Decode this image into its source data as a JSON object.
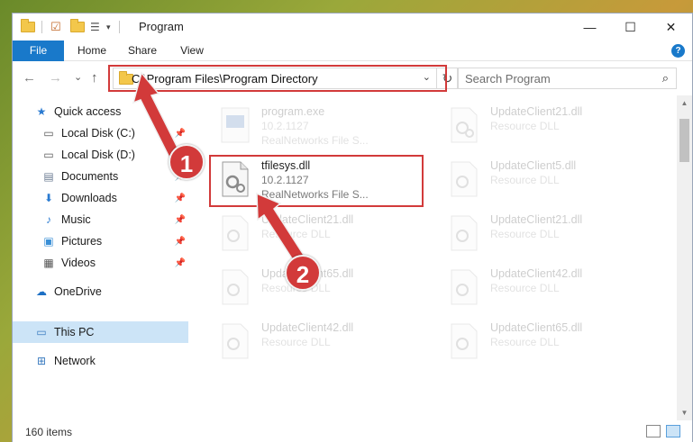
{
  "window": {
    "title": "Program",
    "controls": {
      "minimize": "—",
      "maximize": "☐",
      "close": "✕"
    }
  },
  "ribbon": {
    "tabs": [
      "File",
      "Home",
      "Share",
      "View"
    ],
    "help": "?"
  },
  "nav": {
    "back": "←",
    "forward": "→",
    "recent": "⌄",
    "up": "↑",
    "address": "C:\\Program Files\\Program Directory",
    "refresh": "↻",
    "search_placeholder": "Search Program"
  },
  "sidebar": {
    "items": [
      {
        "label": "Quick access",
        "icon": "star-icon",
        "pinned": false
      },
      {
        "label": "Local Disk (C:)",
        "icon": "drive-icon",
        "pinned": true
      },
      {
        "label": "Local Disk (D:)",
        "icon": "drive-icon",
        "pinned": true
      },
      {
        "label": "Documents",
        "icon": "documents-icon",
        "pinned": true
      },
      {
        "label": "Downloads",
        "icon": "downloads-icon",
        "pinned": true
      },
      {
        "label": "Music",
        "icon": "music-icon",
        "pinned": true
      },
      {
        "label": "Pictures",
        "icon": "pictures-icon",
        "pinned": true
      },
      {
        "label": "Videos",
        "icon": "videos-icon",
        "pinned": true
      },
      {
        "label": "OneDrive",
        "icon": "cloud-icon",
        "pinned": false
      },
      {
        "label": "This PC",
        "icon": "computer-icon",
        "pinned": false,
        "selected": true
      },
      {
        "label": "Network",
        "icon": "network-icon",
        "pinned": false
      }
    ]
  },
  "files": [
    {
      "name": "program.exe",
      "version": "10.2.1127",
      "desc": "RealNetworks File S...",
      "faded": true
    },
    {
      "name": "UpdateClient21.dll",
      "version": "Resource DLL",
      "desc": "",
      "faded": true
    },
    {
      "name": "tfilesys.dll",
      "version": "10.2.1127",
      "desc": "RealNetworks File S...",
      "faded": false
    },
    {
      "name": "UpdateClient5.dll",
      "version": "Resource DLL",
      "desc": "",
      "faded": true
    },
    {
      "name": "UpdateClient21.dll",
      "version": "Resource DLL",
      "desc": "",
      "faded": true
    },
    {
      "name": "UpdateClient21.dll",
      "version": "Resource DLL",
      "desc": "",
      "faded": true
    },
    {
      "name": "UpdateClient65.dll",
      "version": "Resource DLL",
      "desc": "",
      "faded": true
    },
    {
      "name": "UpdateClient42.dll",
      "version": "Resource DLL",
      "desc": "",
      "faded": true
    },
    {
      "name": "UpdateClient42.dll",
      "version": "Resource DLL",
      "desc": "",
      "faded": true
    },
    {
      "name": "UpdateClient65.dll",
      "version": "Resource DLL",
      "desc": "",
      "faded": true
    }
  ],
  "status": {
    "item_count": "160 items"
  },
  "callouts": [
    "1",
    "2"
  ],
  "colors": {
    "accent": "#1979ca",
    "highlight": "#d23a3a",
    "selection": "#cce4f7"
  }
}
